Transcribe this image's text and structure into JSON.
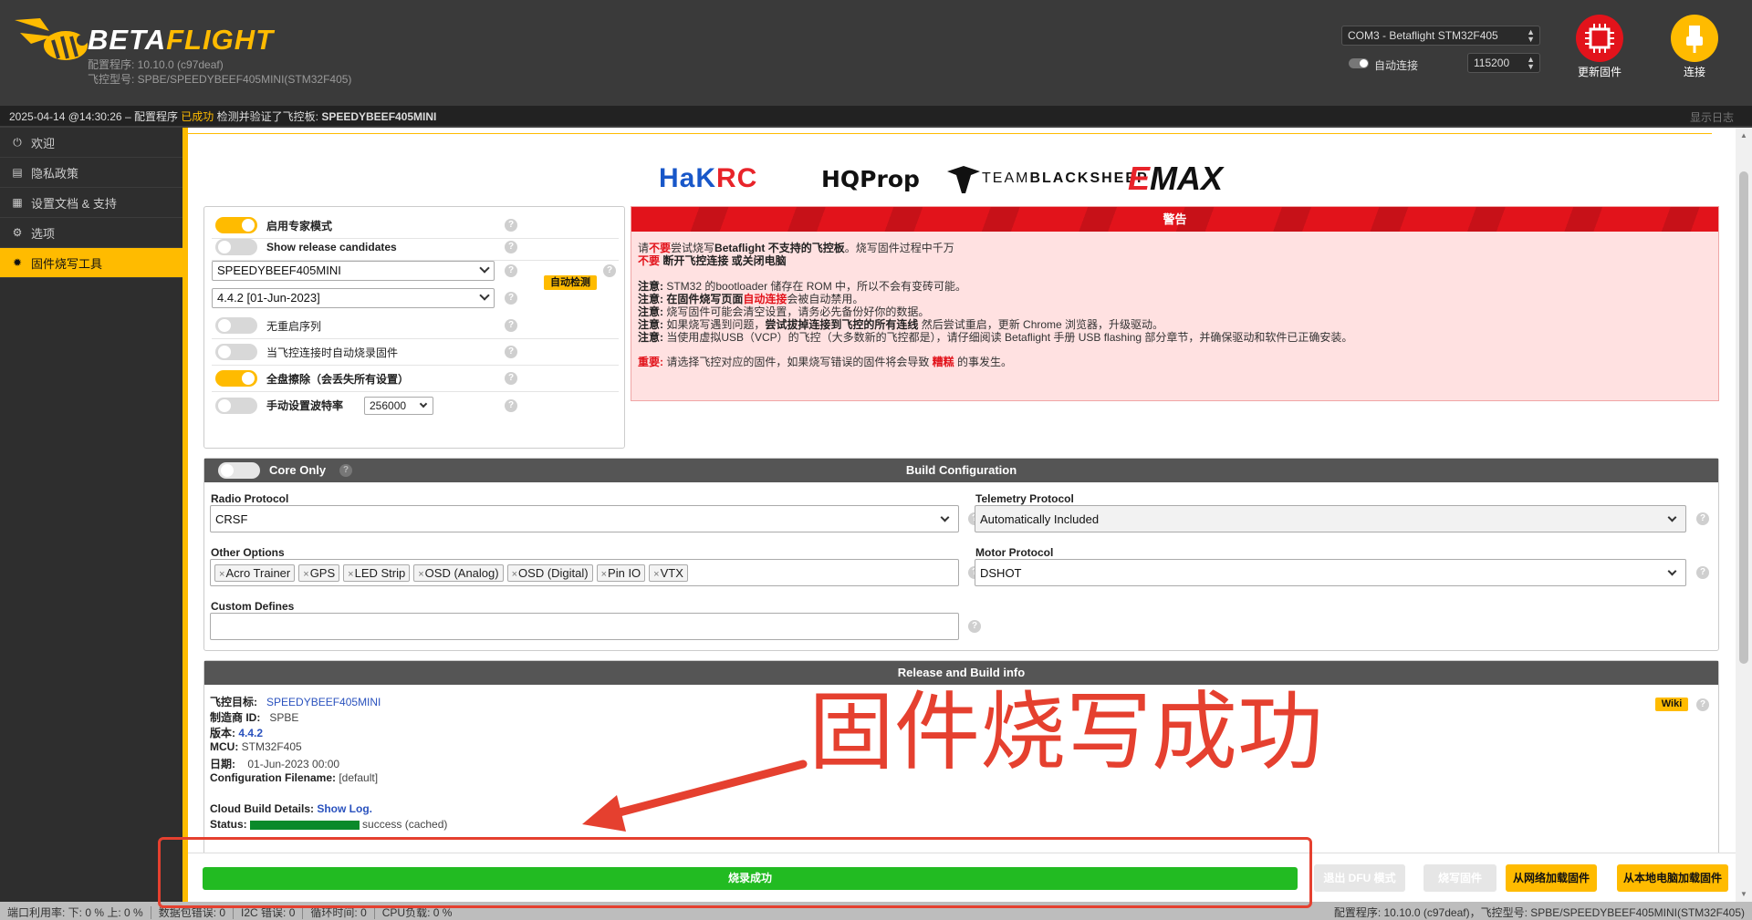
{
  "header": {
    "brand_part1": "BETA",
    "brand_part2": "FLIGHT",
    "configurator_version": "配置程序: 10.10.0 (c97deaf)",
    "board_model": "飞控型号: SPBE/SPEEDYBEEF405MINI(STM32F405)",
    "port": "COM3 - Betaflight STM32F405",
    "baud": "115200",
    "auto_connect_label": "自动连接",
    "update_firmware_label": "更新固件",
    "connect_label": "连接",
    "accent_color": "#ffbb00"
  },
  "statusline": {
    "timestamp": "2025-04-14 @14:30:26",
    "prefix": " – 配置程序 ",
    "ok": "已成功",
    "middle": " 检测并验证了飞控板: ",
    "board": "SPEEDYBEEF405MINI",
    "show_log": "显示日志"
  },
  "sidebar": {
    "items": [
      {
        "label": "欢迎",
        "icon": "plug-icon"
      },
      {
        "label": "隐私政策",
        "icon": "document-icon"
      },
      {
        "label": "设置文档 & 支持",
        "icon": "book-icon"
      },
      {
        "label": "选项",
        "icon": "gear-icon"
      },
      {
        "label": "固件烧写工具",
        "icon": "chip-icon"
      }
    ]
  },
  "sponsors": {
    "hakrc_a": "HaK",
    "hakrc_b": "RC",
    "hqprop": "HQProp",
    "tbs_a": "TEAM",
    "tbs_b": "BLACKSHEEP",
    "emax_a": "E",
    "emax_b": "MAX"
  },
  "options": {
    "expert_mode": "启用专家模式",
    "release_candidates": "Show release candidates",
    "board_value": "SPEEDYBEEF405MINI",
    "auto_detect": "自动检测",
    "version_value": "4.4.2 [01-Jun-2023]",
    "no_reboot": "无重启序列",
    "flash_on_connect": "当飞控连接时自动烧录固件",
    "full_erase": "全盘擦除（会丢失所有设置）",
    "manual_baud": "手动设置波特率",
    "manual_baud_value": "256000",
    "help": "?"
  },
  "warning": {
    "title": "警告",
    "l1a": "请",
    "l1b": "不要",
    "l1c": "尝试烧写",
    "l1d": "Betaflight 不支持的飞控板",
    "l1e": "。烧写固件过程中千万",
    "l2a": "不要",
    "l2b": " 断开飞控连接 或关闭电脑",
    "note": "注意:",
    "n1": " STM32 的bootloader 储存在 ROM 中，所以不会有变砖可能。",
    "n2a": " 在固件烧写页面",
    "n2b": "自动连接",
    "n2c": "会被自动禁用。",
    "n3": " 烧写固件可能会清空设置，请务必先备份好你的数据。",
    "n4a": " 如果烧写遇到问题，",
    "n4b": "尝试拔掉连接到飞控的所有连线",
    "n4c": " 然后尝试重启，更新 Chrome 浏览器，升级驱动。",
    "n5": " 当使用虚拟USB（VCP）的飞控（大多数新的飞控都是），请仔细阅读 Betaflight 手册 USB flashing 部分章节，并确保驱动和软件已正确安装。",
    "important": "重要:",
    "imp_a": " 请选择飞控对应的固件，如果烧写错误的固件将会导致 ",
    "imp_b": "糟糕",
    "imp_c": " 的事发生。"
  },
  "build": {
    "core_only": "Core Only",
    "title": "Build Configuration",
    "radio_label": "Radio Protocol",
    "radio_value": "CRSF",
    "telemetry_label": "Telemetry Protocol",
    "telemetry_value": "Automatically Included",
    "other_label": "Other Options",
    "other_tags": [
      "Acro Trainer",
      "GPS",
      "LED Strip",
      "OSD (Analog)",
      "OSD (Digital)",
      "Pin IO",
      "VTX"
    ],
    "motor_label": "Motor Protocol",
    "motor_value": "DSHOT",
    "custom_label": "Custom Defines",
    "tag_x": "×"
  },
  "release": {
    "title": "Release and Build info",
    "target_label": "飞控目标:",
    "target_value": "SPEEDYBEEF405MINI",
    "mfr_label": "制造商 ID:",
    "mfr_value": "SPBE",
    "version_label": "版本:",
    "version_value": "4.4.2",
    "mcu_label": "MCU:",
    "mcu_value": "STM32F405",
    "date_label": "日期:",
    "date_value": "01-Jun-2023 00:00",
    "cfg_label": "Configuration Filename:",
    "cfg_value": "[default]",
    "cloud_label": "Cloud Build Details:",
    "show_log": "Show Log.",
    "status_label": "Status:",
    "status_value": "success (cached)",
    "wiki": "Wiki"
  },
  "actions": {
    "progress_label": "烧录成功",
    "progress_percent": 100,
    "exit_dfu": "退出 DFU 模式",
    "flash_firmware": "烧写固件",
    "load_online": "从网络加载固件",
    "load_local": "从本地电脑加载固件"
  },
  "footer": {
    "port_usage": "端口利用率:   下: 0 % 上: 0 %",
    "packet_error": "数据包错误: 0",
    "i2c_error": "I2C 错误: 0",
    "cycle_time": "循环时间: 0",
    "cpu_load": "CPU负载: 0 %",
    "right": "配置程序: 10.10.0 (c97deaf)，飞控型号: SPBE/SPEEDYBEEF405MINI(STM32F405)"
  },
  "annotation": {
    "text": "固件烧写成功",
    "color": "#e5402f"
  }
}
